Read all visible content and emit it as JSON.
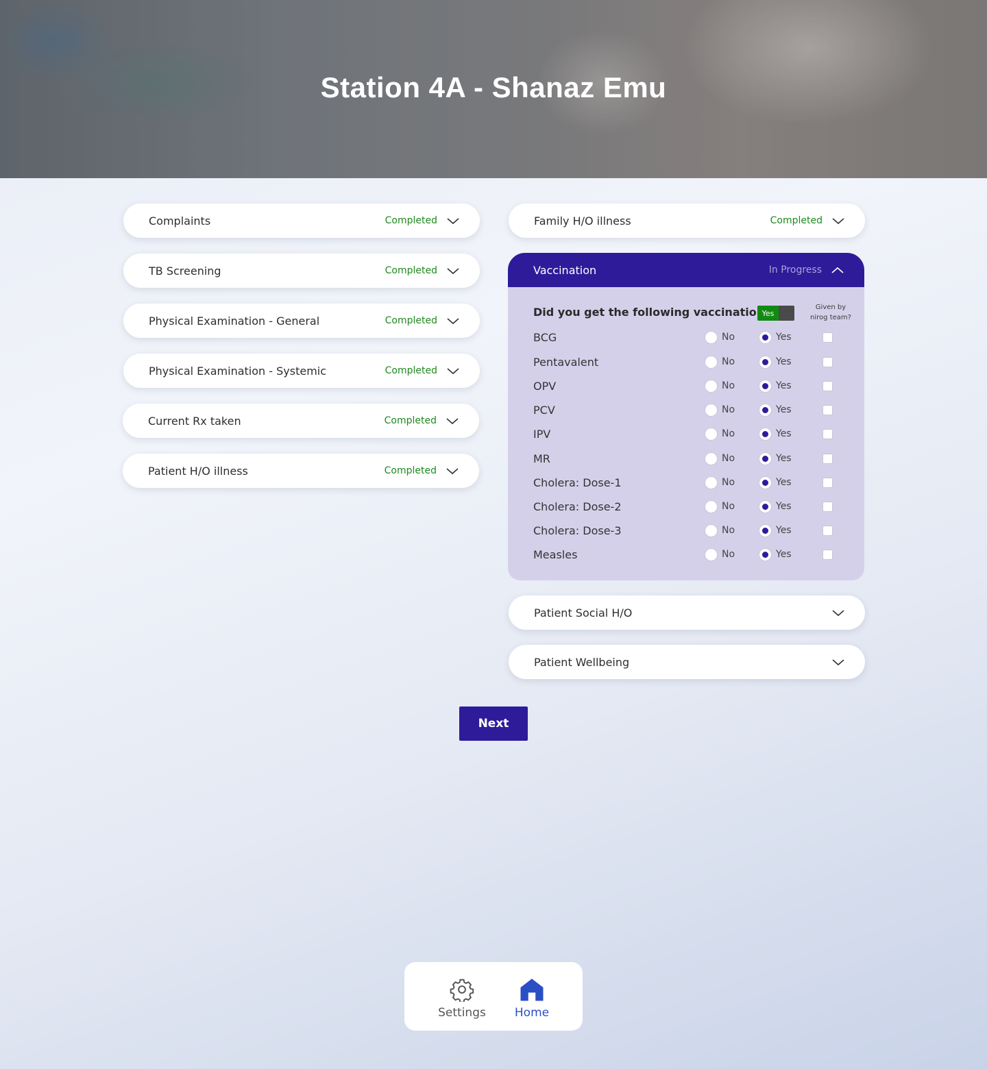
{
  "header": {
    "title": "Station 4A - Shanaz Emu"
  },
  "left_sections": [
    {
      "label": "Complaints",
      "status": "Completed"
    },
    {
      "label": "TB Screening",
      "status": "Completed"
    },
    {
      "label": "Physical Examination - General",
      "status": "Completed"
    },
    {
      "label": "Physical Examination - Systemic",
      "status": "Completed"
    },
    {
      "label": "Current Rx taken",
      "status": "Completed"
    },
    {
      "label": "Patient H/O illness",
      "status": "Completed"
    }
  ],
  "right_sections": {
    "family": {
      "label": "Family H/O illness",
      "status": "Completed"
    },
    "vaccination": {
      "label": "Vaccination",
      "status": "In Progress"
    },
    "social": {
      "label": "Patient Social H/O"
    },
    "wellbeing": {
      "label": "Patient Wellbeing"
    }
  },
  "vaccination": {
    "question": "Did you get the following vaccinations?",
    "toggle_label": "Yes",
    "given_header": "Given by nirog team?",
    "no_label": "No",
    "yes_label": "Yes",
    "items": [
      {
        "name": "BCG",
        "answer": "Yes",
        "given_by_team": false
      },
      {
        "name": "Pentavalent",
        "answer": "Yes",
        "given_by_team": false
      },
      {
        "name": "OPV",
        "answer": "Yes",
        "given_by_team": false
      },
      {
        "name": "PCV",
        "answer": "Yes",
        "given_by_team": false
      },
      {
        "name": "IPV",
        "answer": "Yes",
        "given_by_team": false
      },
      {
        "name": "MR",
        "answer": "Yes",
        "given_by_team": false
      },
      {
        "name": "Cholera: Dose-1",
        "answer": "Yes",
        "given_by_team": false
      },
      {
        "name": "Cholera: Dose-2",
        "answer": "Yes",
        "given_by_team": false
      },
      {
        "name": "Cholera: Dose-3",
        "answer": "Yes",
        "given_by_team": false
      },
      {
        "name": "Measles",
        "answer": "Yes",
        "given_by_team": false
      }
    ]
  },
  "actions": {
    "next_label": "Next"
  },
  "bottom_nav": {
    "settings_label": "Settings",
    "home_label": "Home"
  },
  "colors": {
    "primary": "#2e1b9a",
    "completed": "#1e8a1e",
    "toggle_on": "#128a12",
    "home_active": "#2a4fc4"
  }
}
